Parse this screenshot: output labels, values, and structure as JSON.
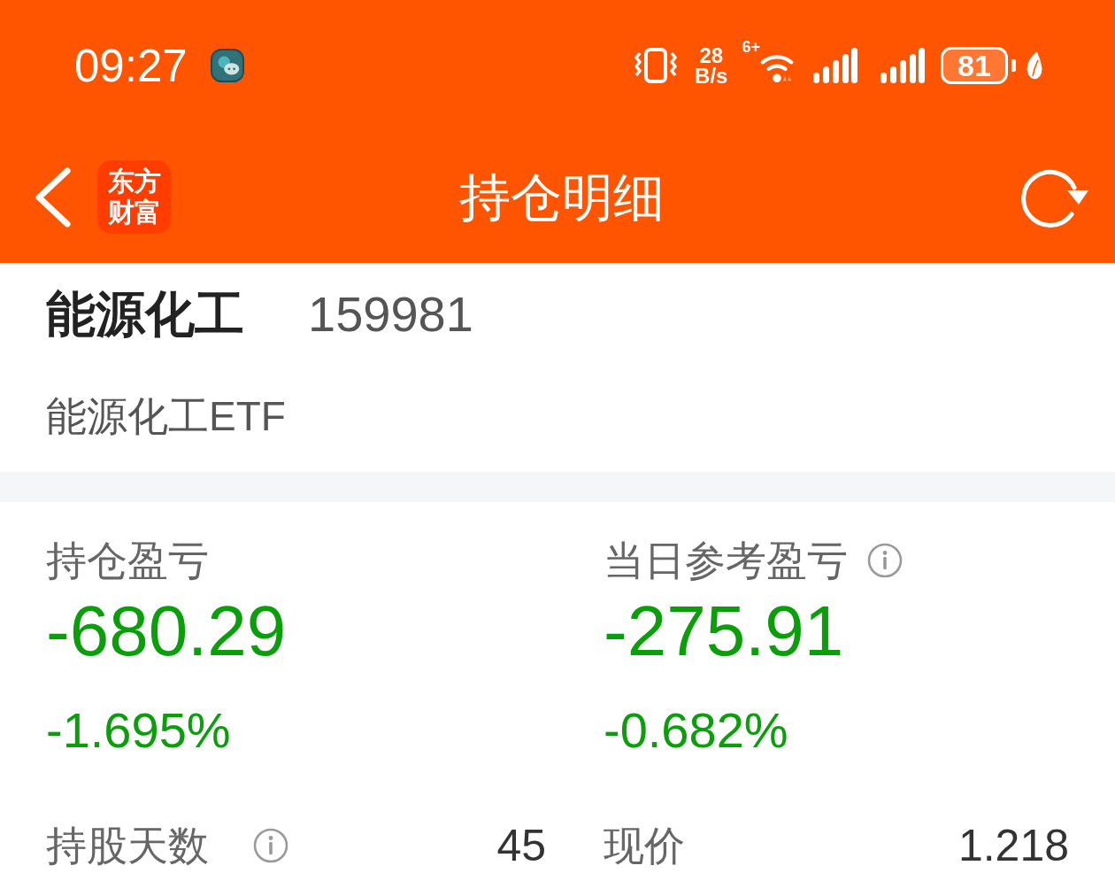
{
  "status_bar": {
    "time": "09:27",
    "network_speed": {
      "value": "28",
      "unit": "B/s"
    },
    "wifi_badge": "6+",
    "battery": "81"
  },
  "nav_bar": {
    "logo_text": "东方财富",
    "title": "持仓明细"
  },
  "security": {
    "name": "能源化工",
    "code": "159981",
    "full_name": "能源化工ETF"
  },
  "summary": [
    {
      "label": "持仓盈亏",
      "info_icon": false,
      "amount": "-680.29",
      "percent": "-1.695%"
    },
    {
      "label": "当日参考盈亏",
      "info_icon": true,
      "amount": "-275.91",
      "percent": "-0.682%"
    }
  ],
  "details": [
    {
      "label": "持股天数",
      "info_icon": true,
      "value": "45"
    },
    {
      "label": "现价",
      "info_icon": false,
      "value": "1.218"
    }
  ]
}
